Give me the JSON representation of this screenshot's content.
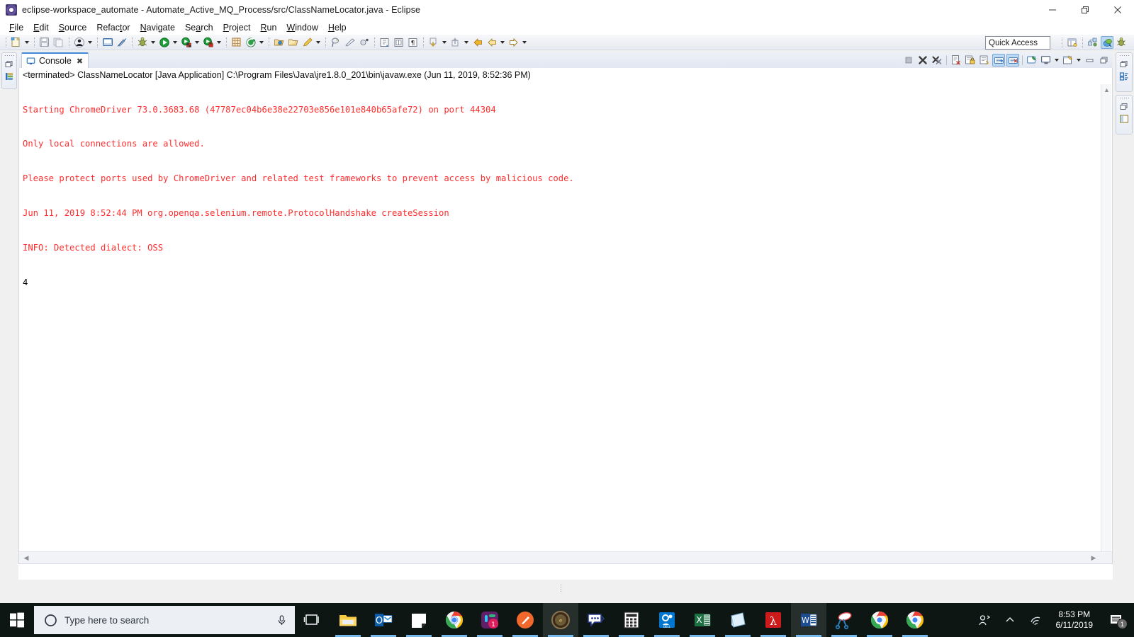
{
  "window": {
    "title": "eclipse-workspace_automate - Automate_Active_MQ_Process/src/ClassNameLocator.java - Eclipse",
    "app_icon": "eclipse-icon",
    "controls": {
      "minimize": "minimize-icon",
      "restore": "restore-icon",
      "close": "close-icon"
    }
  },
  "menu": {
    "items": [
      {
        "label": "File",
        "mnemonic": "F"
      },
      {
        "label": "Edit",
        "mnemonic": "E"
      },
      {
        "label": "Source",
        "mnemonic": "S"
      },
      {
        "label": "Refactor",
        "mnemonic": "t"
      },
      {
        "label": "Navigate",
        "mnemonic": "N"
      },
      {
        "label": "Search",
        "mnemonic": "a"
      },
      {
        "label": "Project",
        "mnemonic": "P"
      },
      {
        "label": "Run",
        "mnemonic": "R"
      },
      {
        "label": "Window",
        "mnemonic": "W"
      },
      {
        "label": "Help",
        "mnemonic": "H"
      }
    ]
  },
  "toolbar": {
    "quick_access_placeholder": "Quick Access",
    "groups": [
      [
        "new-wizard-icon",
        "dropdown",
        "save-icon",
        "save-all-icon"
      ],
      [
        "person-icon",
        "dropdown"
      ],
      [
        "new-java-class-icon",
        "toggle-mark-occurrences-icon"
      ],
      [
        "debug-icon",
        "dropdown",
        "run-icon",
        "dropdown",
        "run-external-tools-icon",
        "dropdown",
        "coverage-icon",
        "dropdown"
      ],
      [
        "new-java-project-icon",
        "new-package-icon",
        "dropdown"
      ],
      [
        "open-type-icon",
        "open-task-icon",
        "edit-icon",
        "dropdown"
      ],
      [
        "search-icon",
        "skip-all-breakpoints-icon",
        "profile-icon"
      ],
      [
        "next-annotation-icon",
        "previous-annotation-icon",
        "toggle-block-selection-icon"
      ],
      [
        "last-edit-location-icon",
        "dropdown",
        "back-icon",
        "dropdown",
        "back-nav-icon",
        "forward-nav-icon",
        "dropdown",
        "forward-icon",
        "dropdown"
      ]
    ],
    "perspective_icons": [
      "open-perspective-icon",
      "java-browsing-perspective-icon",
      "java-perspective-icon",
      "debug-perspective-icon"
    ]
  },
  "left_fastview": {
    "icons": [
      "restore-icon",
      "outline-minimized-icon"
    ]
  },
  "right_fastview": {
    "group1": [
      "restore-icon",
      "package-explorer-minimized-icon"
    ],
    "group2": [
      "restore-icon",
      "outline-view-minimized-icon"
    ]
  },
  "console_view": {
    "tab": {
      "label": "Console",
      "icon": "console-icon",
      "close": "✖"
    },
    "toolbar_icons": [
      "terminate-icon",
      "remove-launch-icon",
      "remove-all-terminated-icon",
      "clear-console-icon",
      "scroll-lock-icon",
      "word-wrap-icon",
      "show-console-on-output-icon",
      "show-console-on-error-icon",
      "pin-console-icon",
      "display-selected-console-icon",
      "dropdown",
      "open-console-icon",
      "dropdown",
      "minimize-icon",
      "maximize-icon"
    ],
    "header": "<terminated> ClassNameLocator [Java Application] C:\\Program Files\\Java\\jre1.8.0_201\\bin\\javaw.exe (Jun 11, 2019, 8:52:36 PM)",
    "error_color": "#ff2d2d",
    "output_color": "#000000",
    "lines": [
      {
        "text": "Starting ChromeDriver 73.0.3683.68 (47787ec04b6e38e22703e856e101e840b65afe72) on port 44304",
        "stream": "error"
      },
      {
        "text": "Only local connections are allowed.",
        "stream": "error"
      },
      {
        "text": "Please protect ports used by ChromeDriver and related test frameworks to prevent access by malicious code.",
        "stream": "error"
      },
      {
        "text": "Jun 11, 2019 8:52:44 PM org.openqa.selenium.remote.ProtocolHandshake createSession",
        "stream": "error"
      },
      {
        "text": "INFO: Detected dialect: OSS",
        "stream": "error"
      },
      {
        "text": "4",
        "stream": "output"
      }
    ]
  },
  "taskbar": {
    "start": "windows-start-icon",
    "search": {
      "placeholder": "Type here to search",
      "icon": "search-circle-icon",
      "mic": "microphone-icon"
    },
    "task_view": "task-view-icon",
    "apps": [
      {
        "name": "file-explorer",
        "running": true,
        "active": false
      },
      {
        "name": "outlook",
        "running": true,
        "active": false
      },
      {
        "name": "sticky-notes",
        "running": true,
        "active": false
      },
      {
        "name": "google-chrome",
        "running": true,
        "active": false
      },
      {
        "name": "slack",
        "running": true,
        "active": false,
        "badge": "1"
      },
      {
        "name": "paint-3d",
        "running": true,
        "active": false
      },
      {
        "name": "eclipse",
        "running": true,
        "active": true
      },
      {
        "name": "messaging",
        "running": true,
        "active": false
      },
      {
        "name": "calculator",
        "running": true,
        "active": false
      },
      {
        "name": "dell-app",
        "running": true,
        "active": false
      },
      {
        "name": "excel",
        "running": true,
        "active": false
      },
      {
        "name": "notepad-journal",
        "running": true,
        "active": false
      },
      {
        "name": "adobe-acrobat",
        "running": true,
        "active": false
      },
      {
        "name": "word",
        "running": true,
        "active": true
      },
      {
        "name": "snipping-tool",
        "running": true,
        "active": false
      },
      {
        "name": "google-chrome-2",
        "running": true,
        "active": false
      },
      {
        "name": "google-chrome-3",
        "running": true,
        "active": false
      }
    ],
    "tray": {
      "people": "people-icon",
      "show_hidden": "show-hidden-icons-chevron",
      "network": "wifi-icon",
      "time": "8:53 PM",
      "date": "6/11/2019",
      "notifications": {
        "icon": "action-center-icon",
        "count": "1"
      }
    }
  }
}
